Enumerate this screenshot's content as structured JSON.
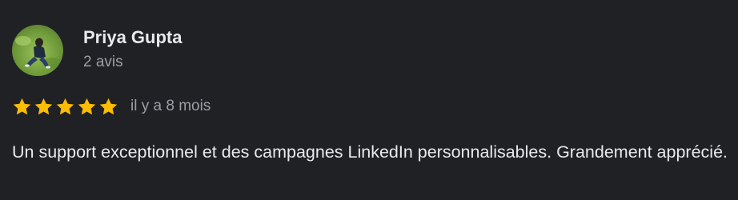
{
  "review": {
    "author": {
      "name": "Priya Gupta",
      "review_count": "2 avis",
      "avatar_icon": "user-photo-avatar"
    },
    "rating": {
      "stars": 5,
      "max_stars": 5,
      "star_color": "#fbbc04",
      "star_icon": "star-icon"
    },
    "relative_date": "il y a 8 mois",
    "text": "Un support exceptionnel et des campagnes LinkedIn personnalisables. Grandement apprécié."
  },
  "colors": {
    "background": "#202124",
    "primary_text": "#e8eaed",
    "secondary_text": "#9aa0a6",
    "accent_star": "#fbbc04"
  }
}
